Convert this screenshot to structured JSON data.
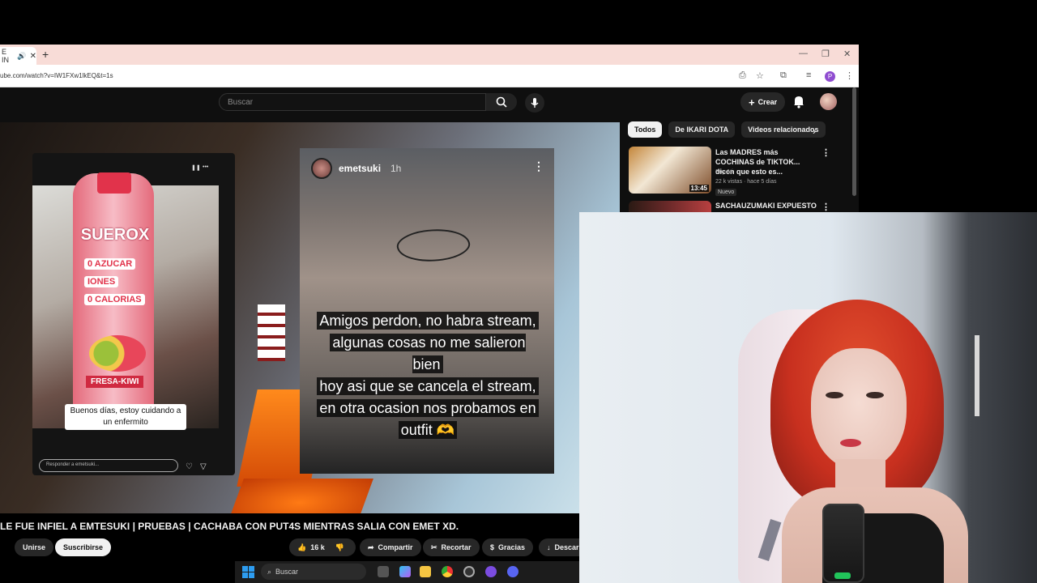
{
  "browser": {
    "tab": {
      "label": "E IN",
      "icons": [
        "speaker-icon",
        "close-icon"
      ]
    },
    "new_tab": "+",
    "url": "ube.com/watch?v=IW1FXw1lkEQ&t=1s",
    "window_controls": [
      "minimize-icon",
      "restore-icon",
      "close-icon"
    ],
    "profile_initial": "P"
  },
  "youtube": {
    "search": {
      "placeholder": "Buscar"
    },
    "create_label": "Crear",
    "video_title": "LE FUE INFIEL A EMTESUKI | PRUEBAS | CACHABA CON PUT4S MIENTRAS SALIA CON EMET XD.",
    "actions": {
      "join": "Unirse",
      "subscribe": "Suscribirse",
      "likes": "16 k",
      "share": "Compartir",
      "clip": "Recortar",
      "thanks": "Gracias",
      "download": "Descar"
    },
    "chips": [
      "Todos",
      "De IKARI DOTA",
      "Videos relacionados"
    ],
    "related": [
      {
        "title": "Las MADRES más COCHINAS de TIKTOK... dicen que esto es...",
        "channel": "Soy Ati",
        "views": "22 k vistas · hace 5 días",
        "badge": "Nuevo",
        "duration": "13:45"
      },
      {
        "title": "SACHAUZUMAKI EXPUESTO"
      }
    ]
  },
  "video": {
    "story1": {
      "brand": "SUEROX",
      "claims": [
        "0 AZUCAR",
        "IONES",
        "0 CALORIAS"
      ],
      "flavor": "FRESA-KIWI",
      "caption": "Buenos días, estoy cuidando a un enfermito",
      "reply_placeholder": "Responder a emetsuki..."
    },
    "story2": {
      "user": "emetsuki",
      "time": "1h",
      "text_lines": [
        "Amigos perdon, no habra stream,",
        "algunas cosas no me salieron bien",
        "hoy asi que se cancela el stream,",
        "en otra ocasion nos probamos en",
        "outfit 🫶"
      ]
    }
  },
  "taskbar": {
    "search_label": "Buscar"
  },
  "colors": {
    "yt_bg": "#0f0f0f",
    "chip_active": "#f1f1f1",
    "accent": "#e1334b"
  }
}
